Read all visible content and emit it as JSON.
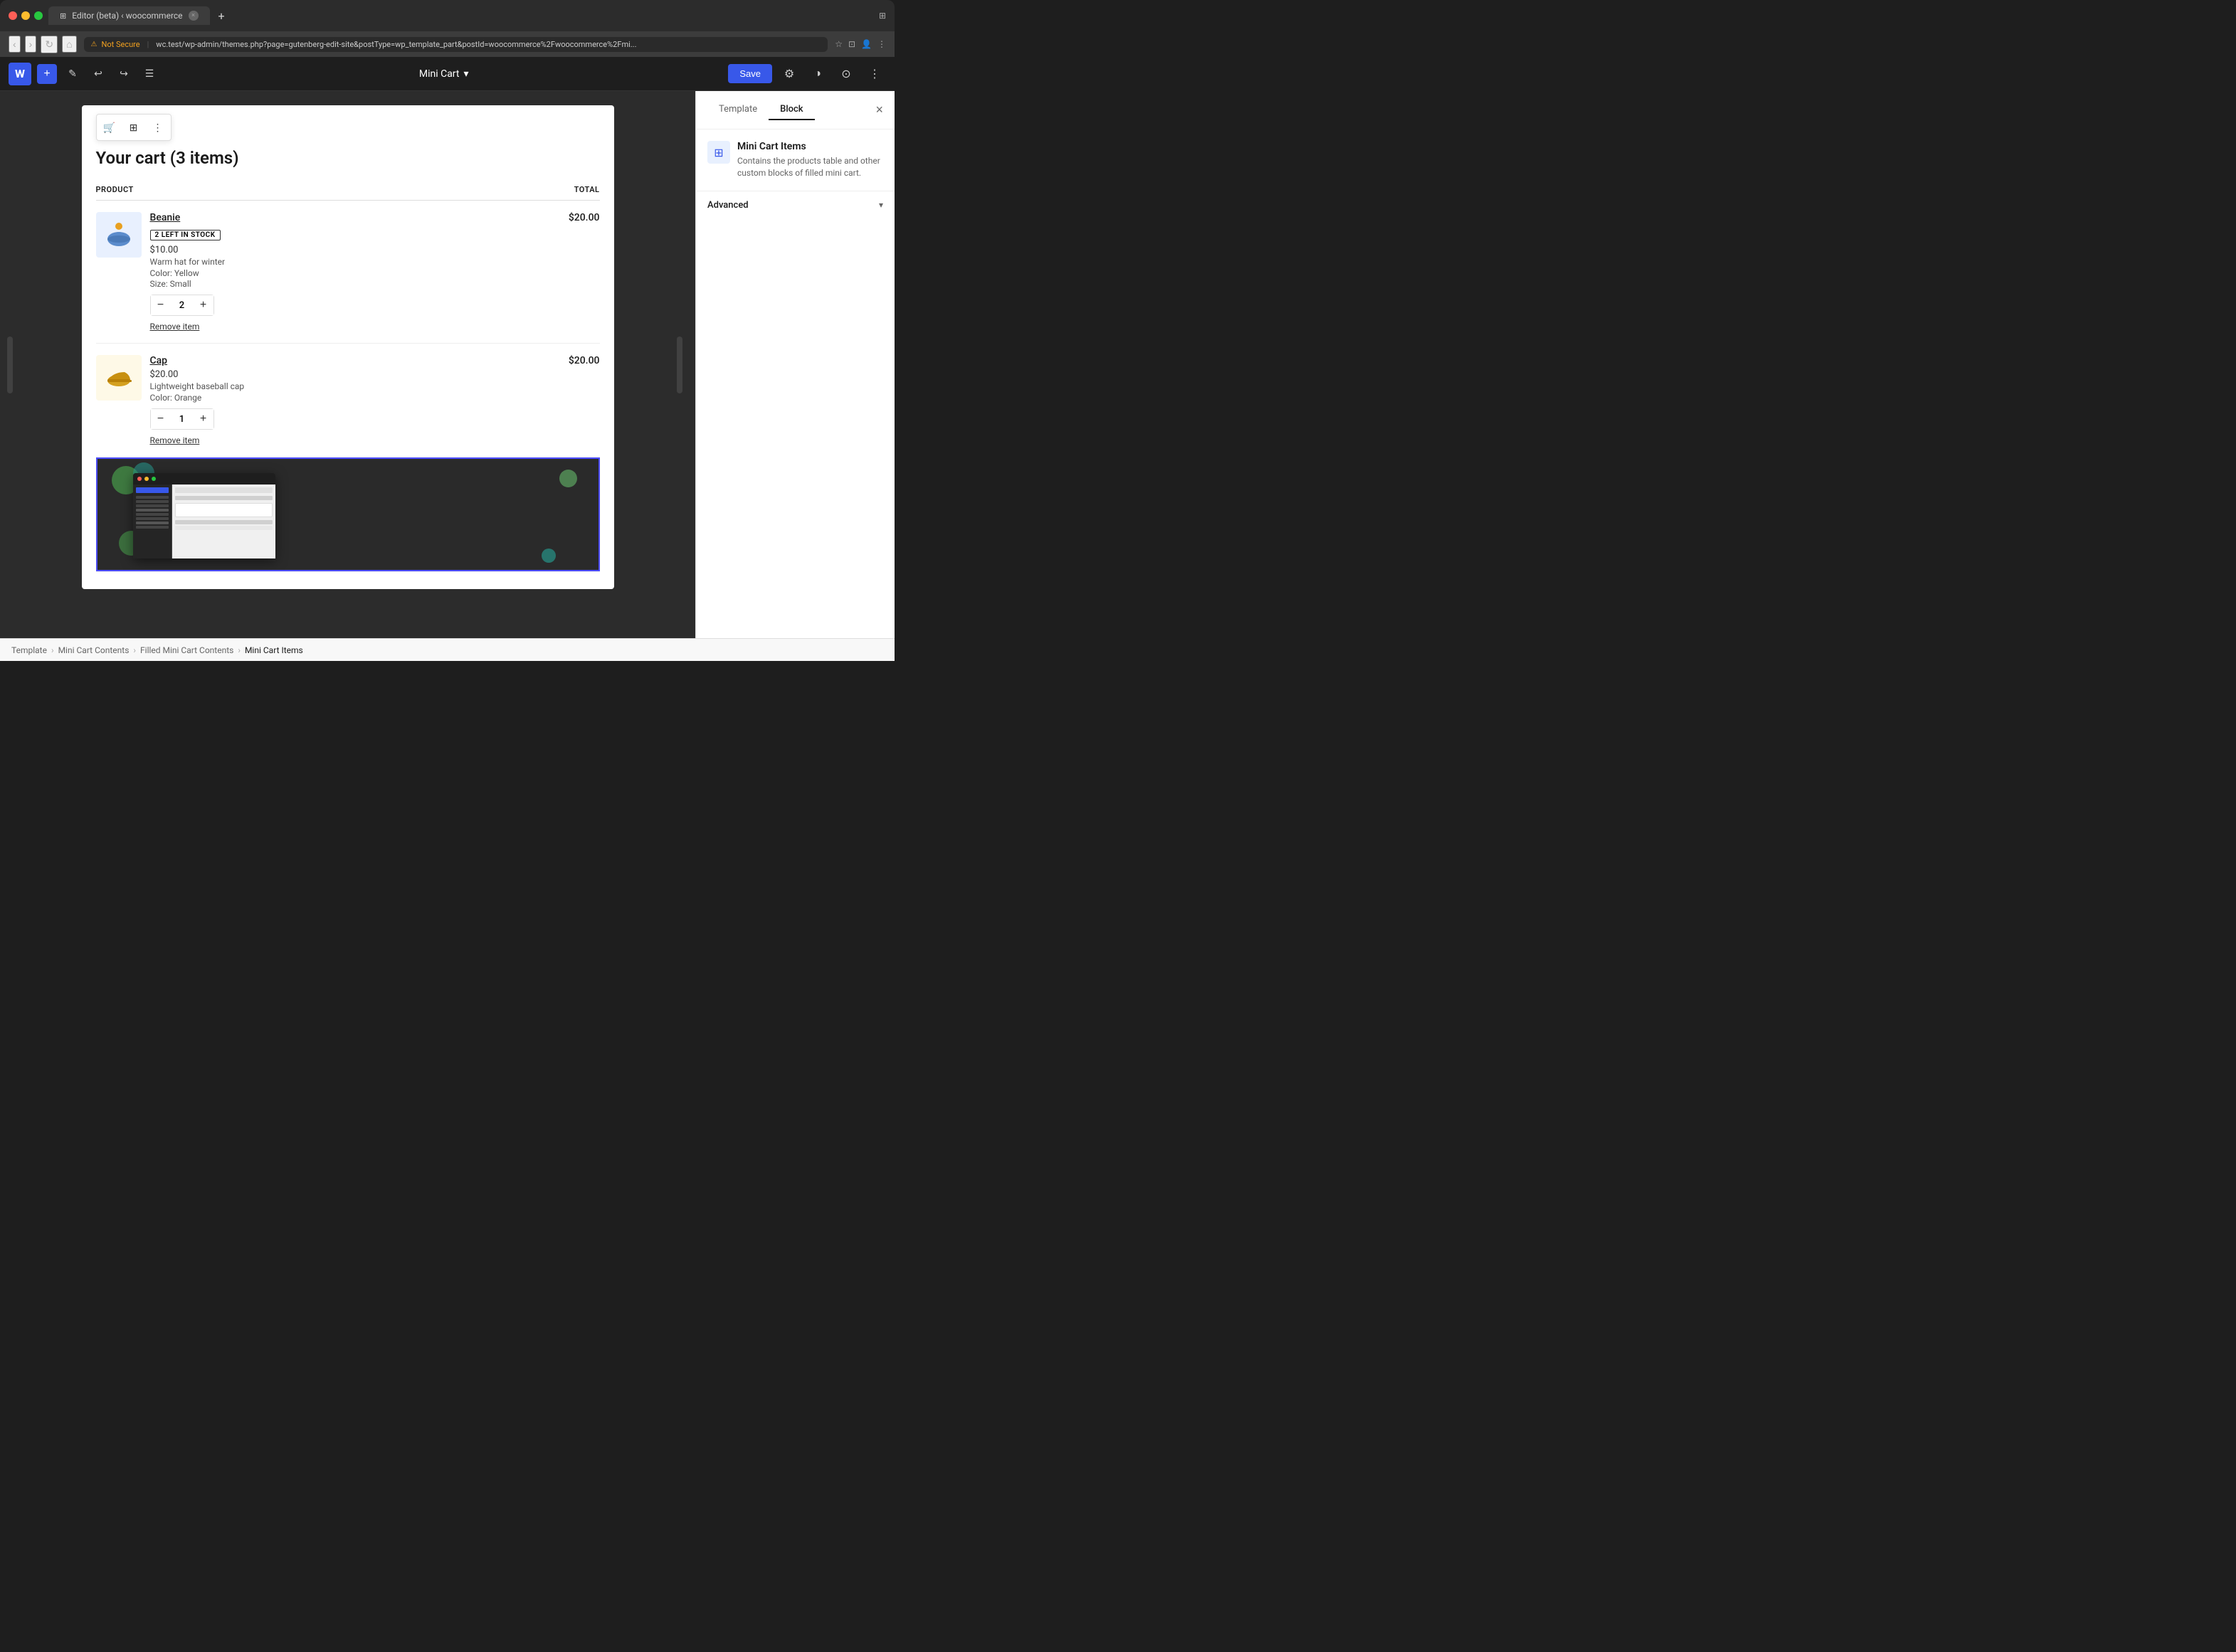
{
  "browser": {
    "tab_title": "Editor (beta) ‹ woocommerce",
    "address": "wc.test/wp-admin/themes.php?page=gutenberg-edit-site&postType=wp_template_part&postId=woocommerce%2Fwoocommerce%2Fmi...",
    "security_label": "Not Secure"
  },
  "toolbar": {
    "save_label": "Save",
    "mini_cart_label": "Mini Cart",
    "chevron": "▾"
  },
  "canvas": {
    "cart_title": "Your cart (3 items)",
    "columns": {
      "product": "PRODUCT",
      "total": "TOTAL"
    },
    "items": [
      {
        "name": "Beanie",
        "stock_badge": "2 LEFT IN STOCK",
        "price": "$10.00",
        "description": "Warm hat for winter",
        "color": "Color: Yellow",
        "size": "Size: Small",
        "quantity": "2",
        "total": "$20.00",
        "remove_label": "Remove item"
      },
      {
        "name": "Cap",
        "price": "$20.00",
        "description": "Lightweight baseball cap",
        "color": "Color: Orange",
        "quantity": "1",
        "total": "$20.00",
        "remove_label": "Remove item"
      }
    ]
  },
  "side_panel": {
    "tab_template": "Template",
    "tab_block": "Block",
    "block_title": "Mini Cart Items",
    "block_desc": "Contains the products table and other custom blocks of filled mini cart.",
    "advanced_label": "Advanced"
  },
  "breadcrumb": {
    "items": [
      "Template",
      "Mini Cart Contents",
      "Filled Mini Cart Contents",
      "Mini Cart Items"
    ]
  }
}
